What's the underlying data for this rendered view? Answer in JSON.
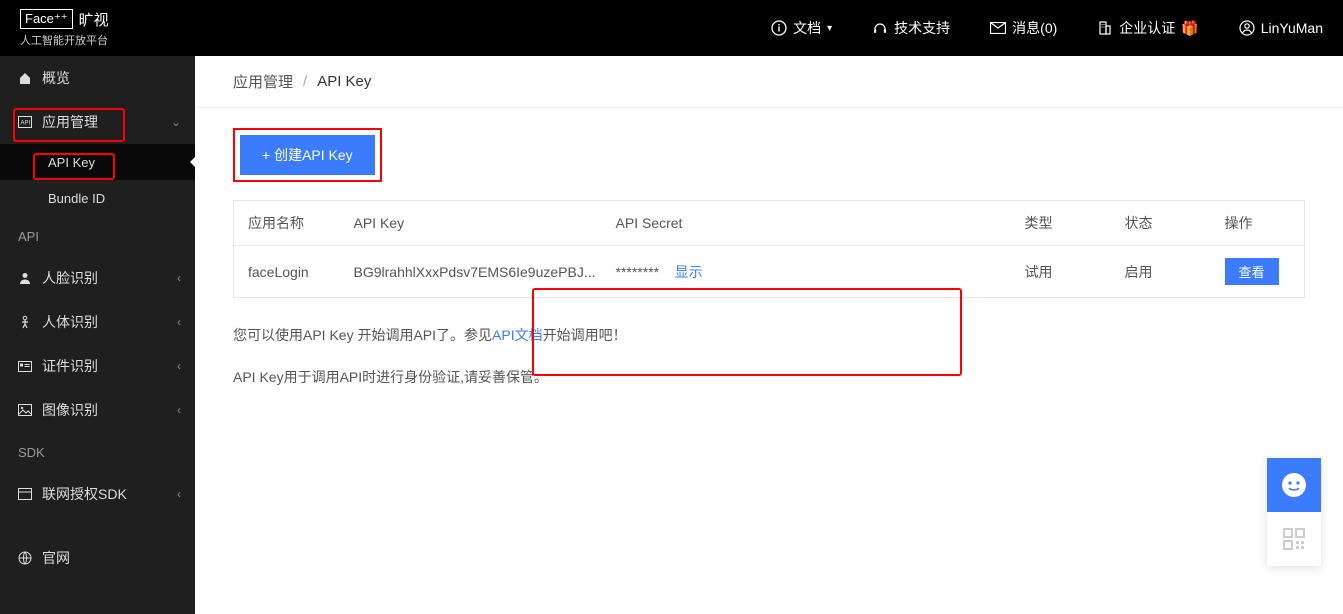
{
  "logo": {
    "badge": "Face⁺⁺",
    "brand": "旷视",
    "tagline": "人工智能开放平台"
  },
  "topnav": {
    "docs": "文档",
    "support": "技术支持",
    "messages_label": "消息",
    "messages_count": 0,
    "enterprise": "企业认证",
    "username": "LinYuMan"
  },
  "sidebar": {
    "overview": "概览",
    "app_manage": "应用管理",
    "app_children": {
      "api_key": "API Key",
      "bundle_id": "Bundle ID"
    },
    "section_api": "API",
    "face": "人脸识别",
    "body": "人体识别",
    "cert": "证件识别",
    "image": "图像识别",
    "section_sdk": "SDK",
    "sdk_auth": "联网授权SDK",
    "official": "官网"
  },
  "breadcrumb": {
    "root": "应用管理",
    "current": "API Key"
  },
  "buttons": {
    "create": "+ 创建API Key",
    "view": "查看",
    "show": "显示"
  },
  "table": {
    "headers": {
      "name": "应用名称",
      "key": "API Key",
      "secret": "API Secret",
      "type": "类型",
      "status": "状态",
      "op": "操作"
    },
    "rows": [
      {
        "name": "faceLogin",
        "key": "BG9lrahhlXxxPdsv7EMS6Ie9uzePBJ...",
        "secret": "********",
        "type": "试用",
        "status": "启用"
      }
    ]
  },
  "tips": {
    "line1_a": "您可以使用API Key 开始调用API了。参见",
    "line1_link": "API文档",
    "line1_b": "开始调用吧！",
    "line2": "API Key用于调用API时进行身份验证,请妥善保管。"
  }
}
